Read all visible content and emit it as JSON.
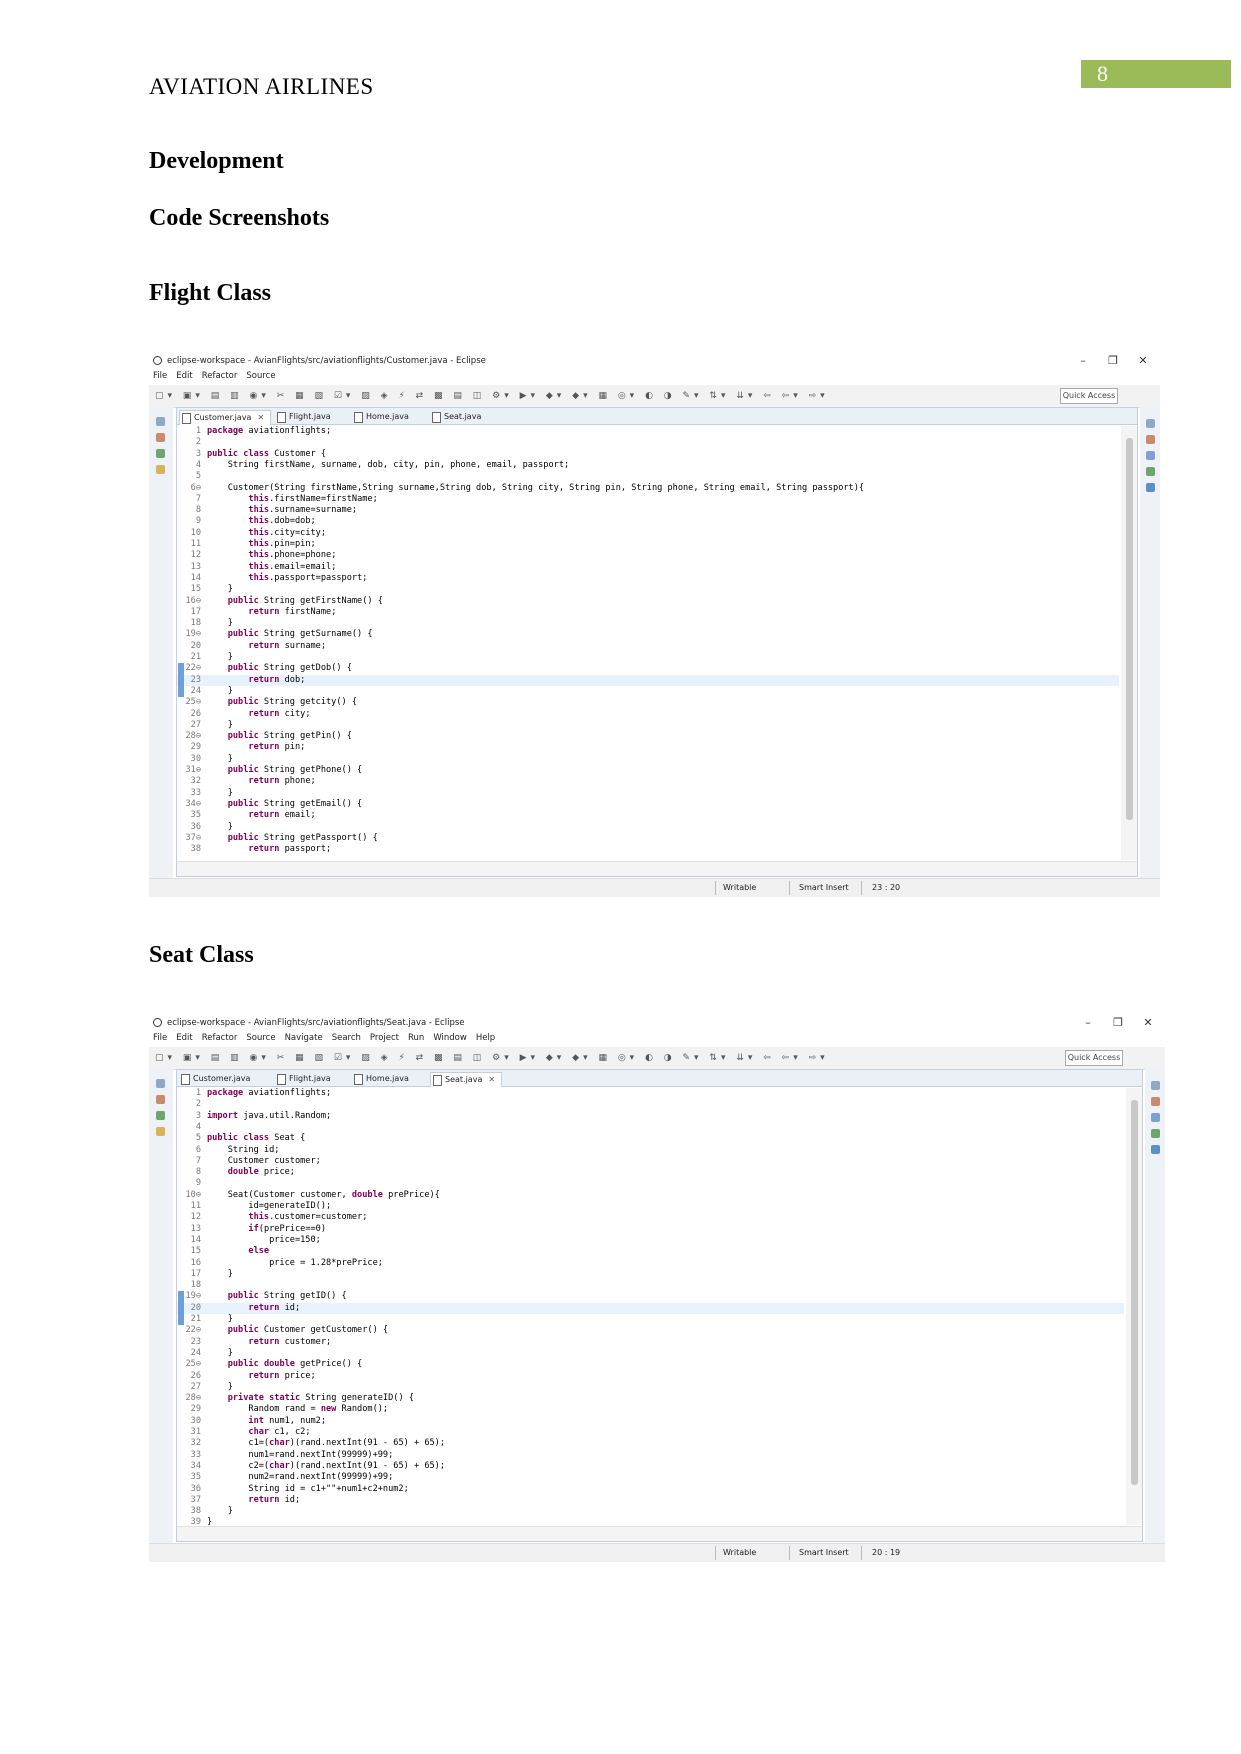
{
  "header": {
    "page_number": "8",
    "running_title": "AVIATION AIRLINES"
  },
  "headings": {
    "development": "Development",
    "code_screenshots": "Code Screenshots",
    "flight_class": "Flight Class",
    "seat_class": "Seat Class"
  },
  "screenshot1": {
    "title": "eclipse-workspace - AvianFlights/src/aviationflights/Customer.java - Eclipse",
    "menu": [
      "File",
      "Edit",
      "Refactor",
      "Source"
    ],
    "quick_access": "Quick Access",
    "tabs": [
      "Customer.java",
      "Flight.java",
      "Home.java",
      "Seat.java"
    ],
    "active_tab": "Customer.java",
    "status": {
      "writable": "Writable",
      "insert_mode": "Smart Insert",
      "position": "23 : 20"
    },
    "code": [
      {
        "n": "1",
        "t": "package aviationflights;"
      },
      {
        "n": "2",
        "t": ""
      },
      {
        "n": "3",
        "t": "public class Customer {"
      },
      {
        "n": "4",
        "t": "    String firstName, surname, dob, city, pin, phone, email, passport;"
      },
      {
        "n": "5",
        "t": ""
      },
      {
        "n": "6⊖",
        "t": "    Customer(String firstName,String surname,String dob, String city, String pin, String phone, String email, String passport){"
      },
      {
        "n": "7",
        "t": "        this.firstName=firstName;"
      },
      {
        "n": "8",
        "t": "        this.surname=surname;"
      },
      {
        "n": "9",
        "t": "        this.dob=dob;"
      },
      {
        "n": "10",
        "t": "        this.city=city;"
      },
      {
        "n": "11",
        "t": "        this.pin=pin;"
      },
      {
        "n": "12",
        "t": "        this.phone=phone;"
      },
      {
        "n": "13",
        "t": "        this.email=email;"
      },
      {
        "n": "14",
        "t": "        this.passport=passport;"
      },
      {
        "n": "15",
        "t": "    }"
      },
      {
        "n": "16⊖",
        "t": "    public String getFirstName() {"
      },
      {
        "n": "17",
        "t": "        return firstName;"
      },
      {
        "n": "18",
        "t": "    }"
      },
      {
        "n": "19⊖",
        "t": "    public String getSurname() {"
      },
      {
        "n": "20",
        "t": "        return surname;"
      },
      {
        "n": "21",
        "t": "    }"
      },
      {
        "n": "22⊖",
        "t": "    public String getDob() {"
      },
      {
        "n": "23",
        "t": "        return dob;"
      },
      {
        "n": "24",
        "t": "    }"
      },
      {
        "n": "25⊖",
        "t": "    public String getcity() {"
      },
      {
        "n": "26",
        "t": "        return city;"
      },
      {
        "n": "27",
        "t": "    }"
      },
      {
        "n": "28⊖",
        "t": "    public String getPin() {"
      },
      {
        "n": "29",
        "t": "        return pin;"
      },
      {
        "n": "30",
        "t": "    }"
      },
      {
        "n": "31⊖",
        "t": "    public String getPhone() {"
      },
      {
        "n": "32",
        "t": "        return phone;"
      },
      {
        "n": "33",
        "t": "    }"
      },
      {
        "n": "34⊖",
        "t": "    public String getEmail() {"
      },
      {
        "n": "35",
        "t": "        return email;"
      },
      {
        "n": "36",
        "t": "    }"
      },
      {
        "n": "37⊖",
        "t": "    public String getPassport() {"
      },
      {
        "n": "38",
        "t": "        return passport;"
      }
    ],
    "highlighted_line": 23
  },
  "screenshot2": {
    "title": "eclipse-workspace - AvianFlights/src/aviationflights/Seat.java - Eclipse",
    "menu": [
      "File",
      "Edit",
      "Refactor",
      "Source",
      "Navigate",
      "Search",
      "Project",
      "Run",
      "Window",
      "Help"
    ],
    "quick_access": "Quick Access",
    "tabs": [
      "Customer.java",
      "Flight.java",
      "Home.java",
      "Seat.java"
    ],
    "active_tab": "Seat.java",
    "status": {
      "writable": "Writable",
      "insert_mode": "Smart Insert",
      "position": "20 : 19"
    },
    "code": [
      {
        "n": "1",
        "t": "package aviationflights;"
      },
      {
        "n": "2",
        "t": ""
      },
      {
        "n": "3",
        "t": "import java.util.Random;"
      },
      {
        "n": "4",
        "t": ""
      },
      {
        "n": "5",
        "t": "public class Seat {"
      },
      {
        "n": "6",
        "t": "    String id;"
      },
      {
        "n": "7",
        "t": "    Customer customer;"
      },
      {
        "n": "8",
        "t": "    double price;"
      },
      {
        "n": "9",
        "t": ""
      },
      {
        "n": "10⊖",
        "t": "    Seat(Customer customer, double prePrice){"
      },
      {
        "n": "11",
        "t": "        id=generateID();"
      },
      {
        "n": "12",
        "t": "        this.customer=customer;"
      },
      {
        "n": "13",
        "t": "        if(prePrice==0)"
      },
      {
        "n": "14",
        "t": "            price=150;"
      },
      {
        "n": "15",
        "t": "        else"
      },
      {
        "n": "16",
        "t": "            price = 1.28*prePrice;"
      },
      {
        "n": "17",
        "t": "    }"
      },
      {
        "n": "18",
        "t": ""
      },
      {
        "n": "19⊖",
        "t": "    public String getID() {"
      },
      {
        "n": "20",
        "t": "        return id;"
      },
      {
        "n": "21",
        "t": "    }"
      },
      {
        "n": "22⊖",
        "t": "    public Customer getCustomer() {"
      },
      {
        "n": "23",
        "t": "        return customer;"
      },
      {
        "n": "24",
        "t": "    }"
      },
      {
        "n": "25⊖",
        "t": "    public double getPrice() {"
      },
      {
        "n": "26",
        "t": "        return price;"
      },
      {
        "n": "27",
        "t": "    }"
      },
      {
        "n": "28⊖",
        "t": "    private static String generateID() {"
      },
      {
        "n": "29",
        "t": "        Random rand = new Random();"
      },
      {
        "n": "30",
        "t": "        int num1, num2;"
      },
      {
        "n": "31",
        "t": "        char c1, c2;"
      },
      {
        "n": "32",
        "t": "        c1=(char)(rand.nextInt(91 - 65) + 65);"
      },
      {
        "n": "33",
        "t": "        num1=rand.nextInt(99999)+99;"
      },
      {
        "n": "34",
        "t": "        c2=(char)(rand.nextInt(91 - 65) + 65);"
      },
      {
        "n": "35",
        "t": "        num2=rand.nextInt(99999)+99;"
      },
      {
        "n": "36",
        "t": "        String id = c1+\"\"+num1+c2+num2;"
      },
      {
        "n": "37",
        "t": "        return id;"
      },
      {
        "n": "38",
        "t": "    }"
      },
      {
        "n": "39",
        "t": "}"
      }
    ],
    "highlighted_line": 20
  }
}
